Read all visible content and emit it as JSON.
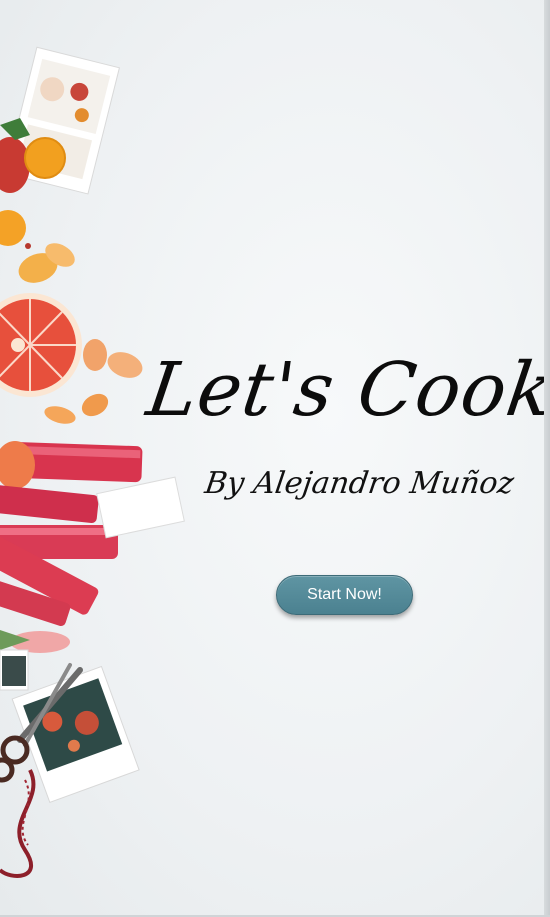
{
  "hero": {
    "title": "Let's Cook!",
    "author": "By Alejandro Muñoz",
    "cta_label": "Start Now!"
  },
  "colors": {
    "background": "#eef1f3",
    "button": "#5690a0",
    "text": "#0c0c0c"
  }
}
